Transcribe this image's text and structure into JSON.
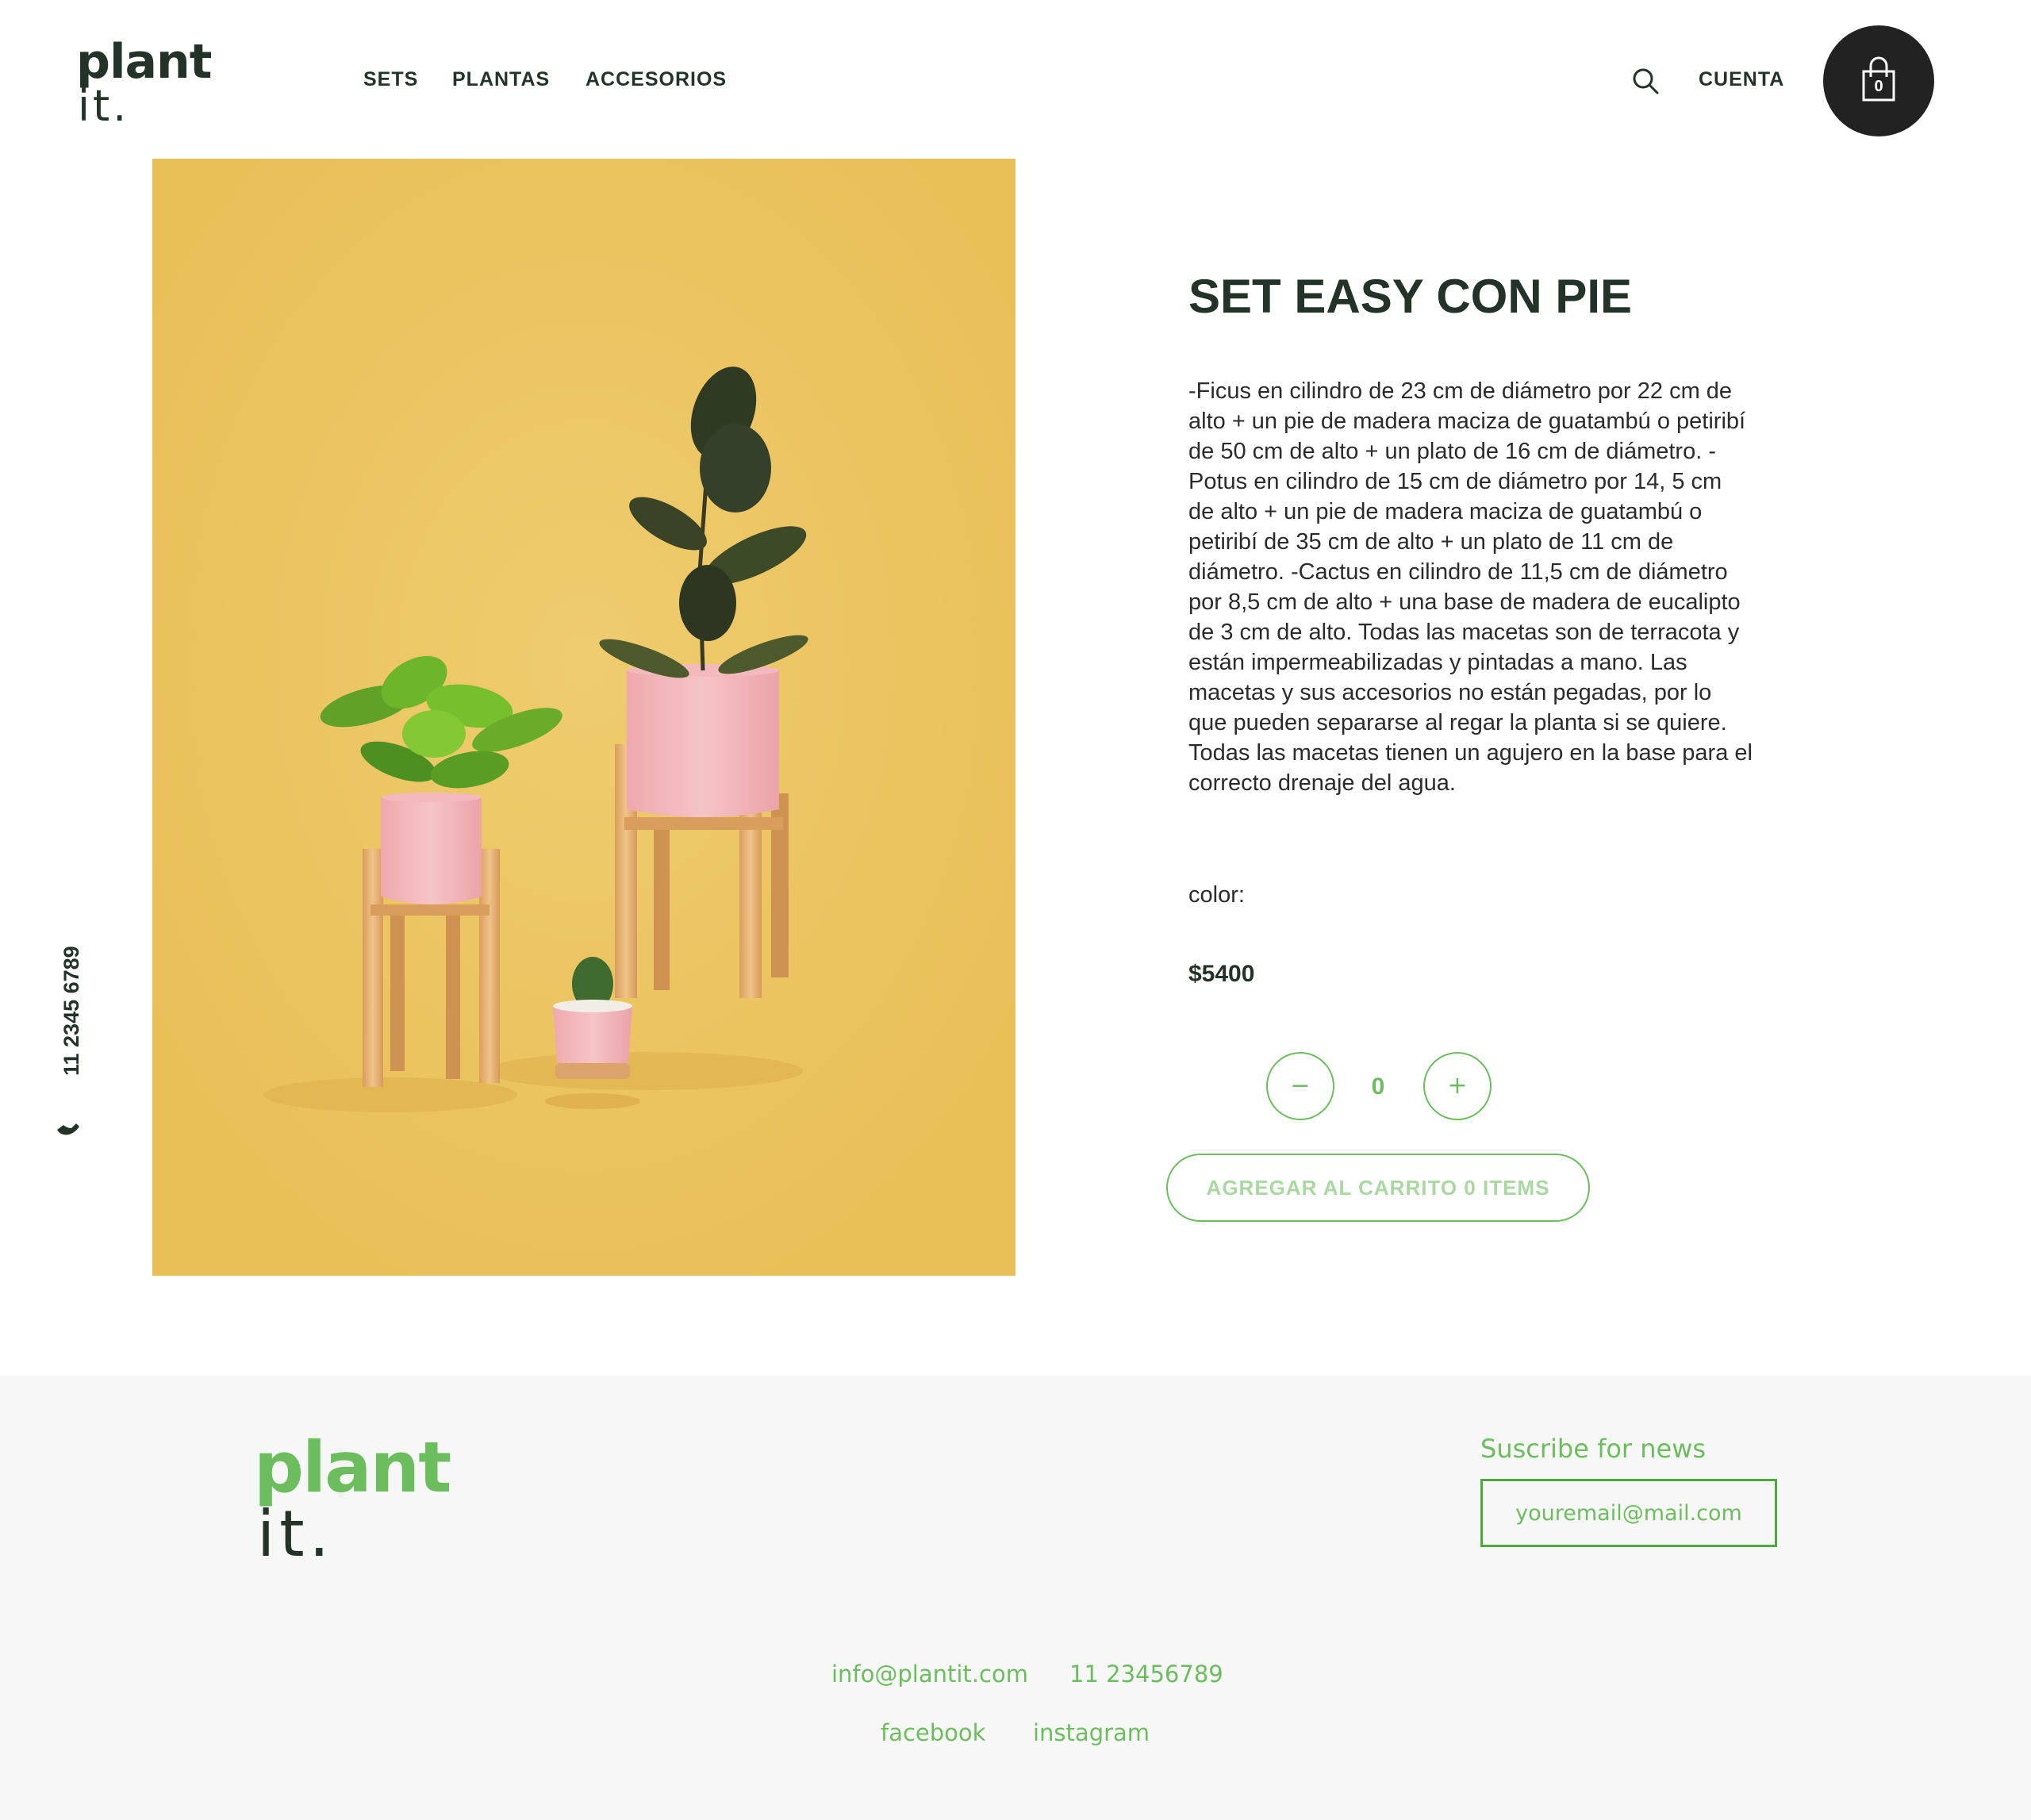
{
  "header": {
    "logo_top": "plant",
    "logo_bottom": "it.",
    "nav": [
      {
        "label": "SETS"
      },
      {
        "label": "PLANTAS"
      },
      {
        "label": "ACCESORIOS"
      }
    ],
    "account_label": "CUENTA",
    "cart_count": "0"
  },
  "side": {
    "phone": "11 2345 6789"
  },
  "product": {
    "title": "SET EASY CON PIE",
    "description": "-Ficus en cilindro de 23 cm de diámetro por 22 cm de alto + un pie de madera maciza de guatambú o petiribí de 50 cm de alto + un plato de 16 cm de diámetro. -Potus en cilindro de 15 cm de diámetro por 14, 5 cm de alto + un pie de madera maciza de guatambú o petiribí de 35 cm de alto + un plato de 11 cm de diámetro. -Cactus en cilindro de 11,5 cm de diámetro por 8,5 cm de alto + una base de madera de eucalipto de 3 cm de alto. Todas las macetas son de terracota y están impermeabilizadas y pintadas a mano. Las macetas y sus accesorios no están pegadas, por lo que pueden separarse al regar la planta si se quiere. Todas las macetas tienen un agujero en la base para el correcto drenaje del agua.",
    "color_label": "color:",
    "price": "$5400",
    "quantity": "0",
    "minus_symbol": "−",
    "plus_symbol": "+",
    "add_to_cart_label": "AGREGAR AL CARRITO 0 ITEMS"
  },
  "footer": {
    "logo_top": "plant",
    "logo_bottom": "it.",
    "subscribe_title": "Suscribe for news",
    "subscribe_placeholder": "youremail@mail.com",
    "email": "info@plantit.com",
    "phone": "11 23456789",
    "facebook": "facebook",
    "instagram": "instagram"
  },
  "colors": {
    "dark_green": "#233329",
    "accent_green": "#6cbd5e",
    "image_background": "#ebc462",
    "cart_button": "#222222",
    "footer_background": "#f7f7f7"
  },
  "icons": {
    "search": "search-icon",
    "cart": "shopping-bag-icon",
    "phone": "phone-icon"
  }
}
